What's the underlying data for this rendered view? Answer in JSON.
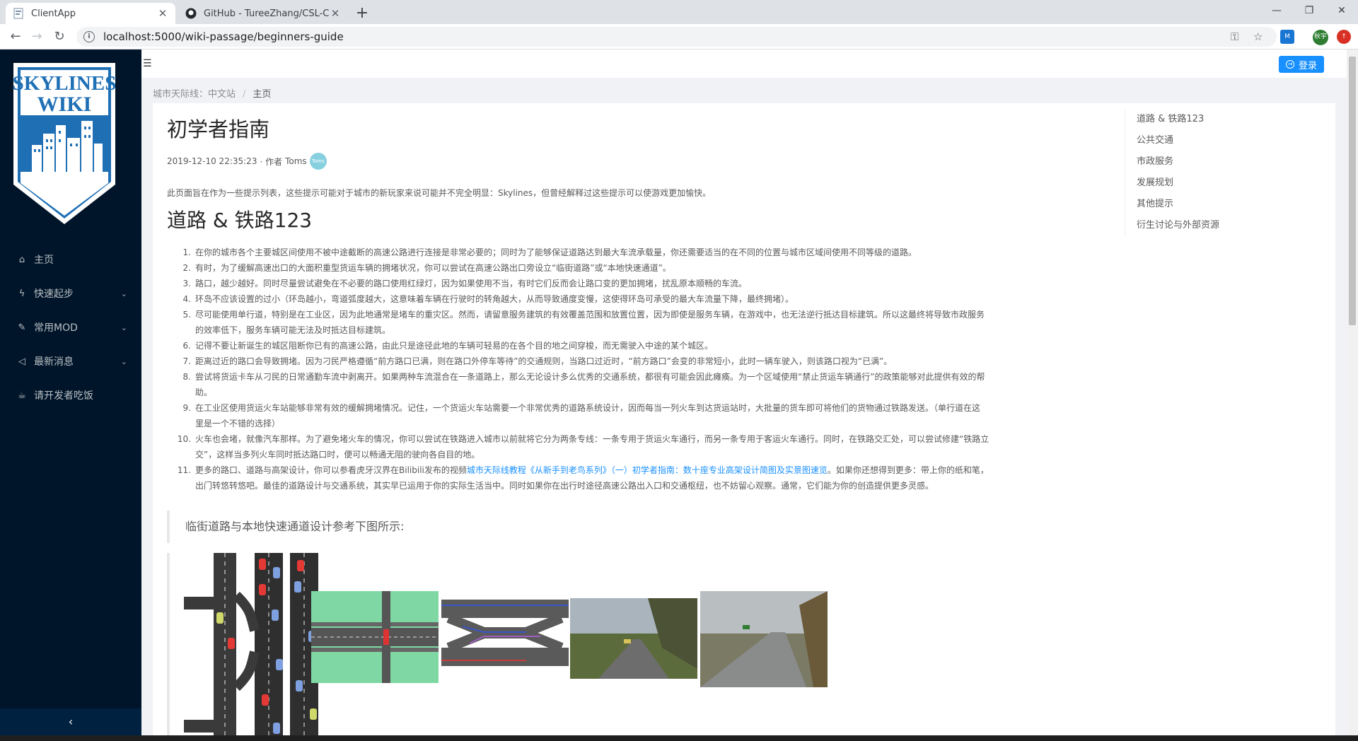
{
  "browser": {
    "tabs": [
      {
        "title": "ClientApp",
        "active": true
      },
      {
        "title": "GitHub - TureeZhang/CSL-CN",
        "active": false
      }
    ],
    "url": "localhost:5000/wiki-passage/beginners-guide",
    "profile": "秋宇"
  },
  "sidebar": {
    "logo_line1": "SKYLINES",
    "logo_line2": "WIKI",
    "items": [
      {
        "label": "主页",
        "icon": "home-icon",
        "submenu": false
      },
      {
        "label": "快速起步",
        "icon": "bolt-icon",
        "submenu": true
      },
      {
        "label": "常用MOD",
        "icon": "wrench-icon",
        "submenu": true
      },
      {
        "label": "最新消息",
        "icon": "notification-icon",
        "submenu": true
      },
      {
        "label": "请开发者吃饭",
        "icon": "coffee-icon",
        "submenu": false
      }
    ]
  },
  "header": {
    "login_label": "登录"
  },
  "breadcrumb": {
    "root": "城市天际线：中文站",
    "separator": "/",
    "current": "主页"
  },
  "article": {
    "title": "初学者指南",
    "meta_date": "2019-12-10 22:35:23",
    "meta_author_prefix": "· 作者",
    "author": "Toms",
    "avatar_text": "Toms",
    "intro": "此页面旨在作为一些提示列表，这些提示可能对于城市的新玩家来说可能并不完全明显：Skylines，但曾经解释过这些提示可以使游戏更加愉快。",
    "section_title": "道路 & 铁路123",
    "steps": [
      {
        "num": "1.",
        "text": "在你的城市各个主要城区间使用不被中途截断的高速公路进行连接是非常必要的；同时为了能够保证道路达到最大车流承载量，你还需要适当的在不同的位置与城市区域间使用不同等级的道路。"
      },
      {
        "num": "2.",
        "text": "有时，为了缓解高速出口的大面积重型货运车辆的拥堵状况，你可以尝试在高速公路出口旁设立“临街道路”或“本地快速通道”。"
      },
      {
        "num": "3.",
        "text": "路口，越少越好。同时尽量尝试避免在不必要的路口使用红绿灯，因为如果使用不当，有时它们反而会让路口变的更加拥堵，扰乱原本顺畅的车流。"
      },
      {
        "num": "4.",
        "text": "环岛不应该设置的过小（环岛越小，弯道弧度越大，这意味着车辆在行驶时的转角越大，从而导致通度变慢，这使得环岛可承受的最大车流量下降，最终拥堵）。"
      },
      {
        "num": "5.",
        "text": "尽可能使用单行道，特别是在工业区，因为此地通常是堵车的重灾区。然而，请留意服务建筑的有效覆盖范围和放置位置，因为即使是服务车辆，在游戏中，也无法逆行抵达目标建筑。所以这最终将导致市政服务"
      },
      {
        "num": "",
        "text": "的效率低下，服务车辆可能无法及时抵达目标建筑。"
      },
      {
        "num": "6.",
        "text": "记得不要让新诞生的城区阻断你已有的高速公路，由此只是途径此地的车辆可轻易的在各个目的地之间穿梭，而无需驶入中途的某个城区。"
      },
      {
        "num": "7.",
        "text": "距离过近的路口会导致拥堵。因为刁民严格遵循“前方路口已满，则在路口外停车等待”的交通规则，当路口过近时，“前方路口”会变的非常短小，此时一辆车驶入，则该路口视为“已满”。"
      },
      {
        "num": "8.",
        "text": "尝试将货运卡车从刁民的日常通勤车流中剥离开。如果两种车流混合在一条道路上，那么无论设计多么优秀的交通系统，都很有可能会因此瘫痪。为一个区域使用“禁止货运车辆通行”的政策能够对此提供有效的帮"
      },
      {
        "num": "",
        "text": "助。"
      },
      {
        "num": "9.",
        "text": "在工业区使用货运火车站能够非常有效的缓解拥堵情况。记住，一个货运火车站需要一个非常优秀的道路系统设计，因而每当一列火车到达货运站时，大批量的货车即可将他们的货物通过铁路发送。（单行道在这"
      },
      {
        "num": "",
        "text": "里是一个不错的选择）"
      },
      {
        "num": "10.",
        "text": "火车也会堵，就像汽车那样。为了避免堵火车的情况，你可以尝试在铁路进入城市以前就将它分为两条专线：一条专用于货运火车通行，而另一条专用于客运火车通行。同时，在铁路交汇处，可以尝试修建“铁路立"
      },
      {
        "num": "",
        "text": "交”，这样当多列火车同时抵达路口时，便可以畅通无阻的驶向各自目的地。"
      },
      {
        "num": "11.",
        "text_before": "更多的路口、道路与高架设计，你可以参看虎牙汉界在Bilibili发布的视频",
        "link": "城市天际线教程《从新手到老鸟系列》（一）初学者指南：数十座专业高架设计简图及实景图速览",
        "text_after": "。如果你还想得到更多：带上你的纸和笔，"
      },
      {
        "num": "",
        "text": "出门转悠转悠吧。最佳的道路设计与交通系统，其实早已运用于你的实际生活当中。同时如果你在出行时途径高速公路出入口和交通枢纽，也不妨留心观察。通常，它们能为你的创造提供更多灵感。"
      }
    ],
    "quote": "临街道路与本地快速通道设计参考下图所示:"
  },
  "toc": [
    "道路 & 铁路123",
    "公共交通",
    "市政服务",
    "发展规划",
    "其他提示",
    "衍生讨论与外部资源"
  ],
  "colors": {
    "sider": "#001529",
    "primary": "#1890ff",
    "logo_blue": "#1f6fb5"
  }
}
